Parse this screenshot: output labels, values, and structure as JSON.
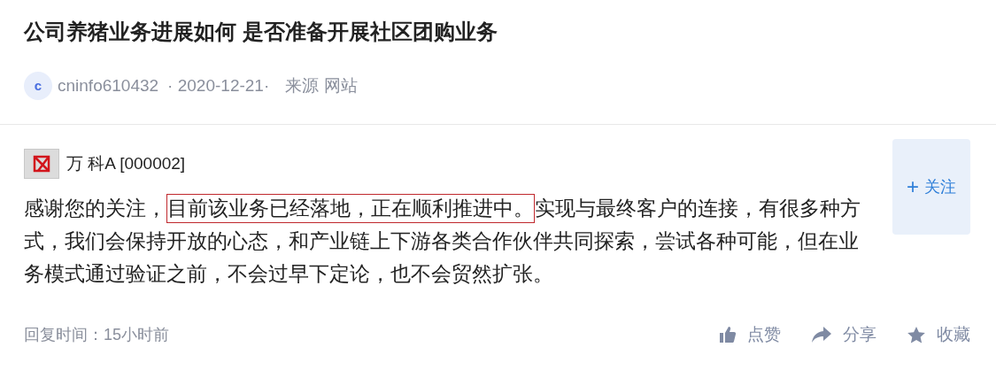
{
  "title": "公司养猪业务进展如何 是否准备开展社区团购业务",
  "meta": {
    "avatar_letter": "c",
    "author": "cninfo610432",
    "date": "· 2020-12-21·",
    "source": "来源 网站"
  },
  "company": {
    "name": "万 科A [000002]"
  },
  "follow_button": {
    "icon": "+",
    "label": "关注"
  },
  "answer": [
    {
      "text": "感谢您的关注，",
      "highlighted": false
    },
    {
      "text": "目前该业务已经落地，正在顺利推进中。",
      "highlighted": true
    },
    {
      "text": "实现与最终客户的连接，有很多种方式，我们会保持开放的心态，和产业链上下游各类合作伙伴共同探索，尝试各种可能，但在业务模式通过验证之前，不会过早下定论，也不会贸然扩张。",
      "highlighted": false
    }
  ],
  "reply_time": "回复时间：15小时前",
  "actions": [
    {
      "kind": "like",
      "label": "点赞"
    },
    {
      "kind": "share",
      "label": "分享"
    },
    {
      "kind": "favorite",
      "label": "收藏"
    }
  ]
}
